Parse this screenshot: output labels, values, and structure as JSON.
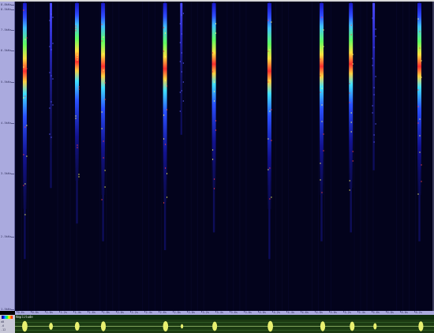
{
  "frequency_axis": {
    "labels": [
      "8.8kHz",
      "8.5kHz",
      "7.5kHz",
      "6.5kHz",
      "5.5kHz",
      "4.5kHz",
      "3.5kHz",
      "2.5kHz",
      "1.5kHz",
      "0.5kHz"
    ]
  },
  "time_axis": {
    "labels": [
      "0.6s",
      "0.8s",
      "1.0s",
      "1.2s",
      "1.4s",
      "1.6s",
      "1.8s",
      "2.0s",
      "2.2s",
      "2.4s",
      "2.6s",
      "2.8s",
      "3.0s",
      "3.2s",
      "3.4s",
      "3.6s",
      "3.8s",
      "4.0s",
      "4.2s",
      "4.4s",
      "4.6s",
      "4.8s",
      "5.0s",
      "5.2s",
      "5.4s",
      "5.6s",
      "5.8s",
      "6.0s",
      "6.2s"
    ]
  },
  "amplitude_panel": {
    "title": "Amplitude",
    "scale_labels": [
      "dB",
      "-6",
      "-12"
    ]
  },
  "colors": {
    "background": "#03031c",
    "axis": "#aaaade",
    "amplitude_bg": "#1b3a12",
    "waveform": "#e8f070"
  },
  "calls": [
    {
      "time_s": 0.75,
      "intensity": 0.95
    },
    {
      "time_s": 1.15,
      "intensity": 0.55
    },
    {
      "time_s": 1.55,
      "intensity": 0.75
    },
    {
      "time_s": 1.95,
      "intensity": 0.85
    },
    {
      "time_s": 2.9,
      "intensity": 0.9
    },
    {
      "time_s": 3.15,
      "intensity": 0.25
    },
    {
      "time_s": 3.65,
      "intensity": 0.8
    },
    {
      "time_s": 4.5,
      "intensity": 0.95
    },
    {
      "time_s": 5.3,
      "intensity": 0.85
    },
    {
      "time_s": 5.75,
      "intensity": 0.8
    },
    {
      "time_s": 6.1,
      "intensity": 0.45
    },
    {
      "time_s": 6.8,
      "intensity": 0.85
    }
  ]
}
